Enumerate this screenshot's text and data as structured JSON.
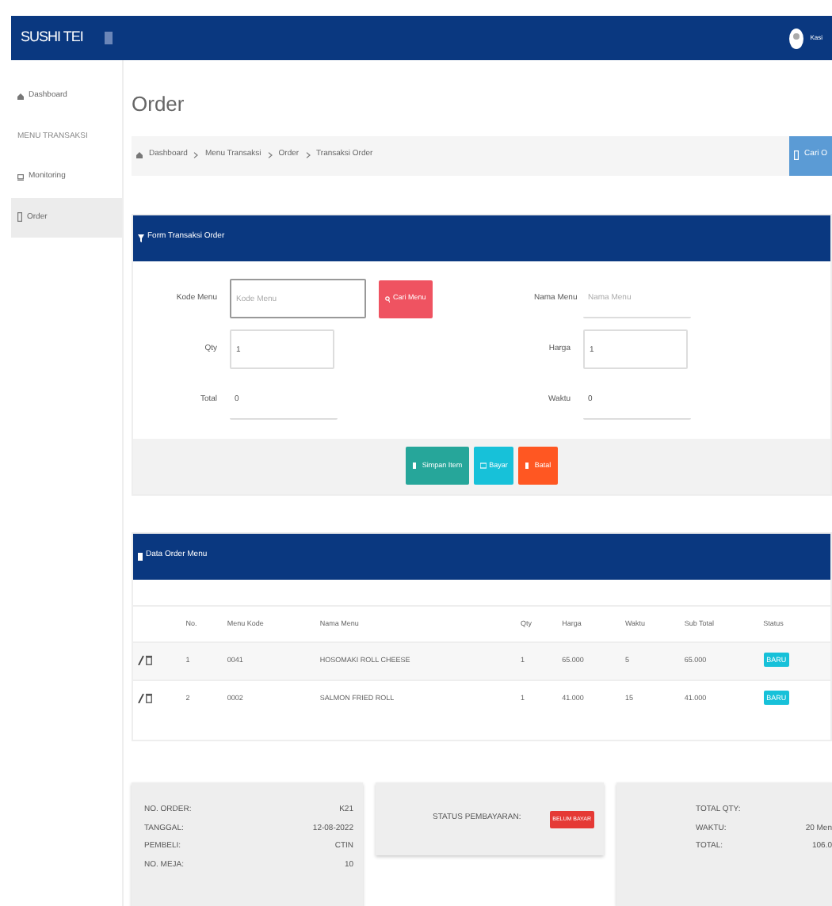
{
  "navbar": {
    "brand": "SUSHI TEI",
    "user": "Kasi"
  },
  "sidebar": {
    "items": [
      {
        "kind": "link",
        "label": "Dashboard",
        "selected": false
      },
      {
        "kind": "heading",
        "label": "MENU TRANSAKSI"
      },
      {
        "kind": "link",
        "label": "Monitoring",
        "selected": false
      },
      {
        "kind": "link",
        "label": "Order",
        "selected": true
      }
    ]
  },
  "page_title": "Order",
  "breadcrumb": [
    "Dashboard",
    "Menu Transaksi",
    "Order",
    "Transaksi Order"
  ],
  "search_order_button": "Cari O",
  "form": {
    "title": "Form Transaksi Order",
    "left": [
      {
        "label": "Kode Menu",
        "placeholder": "Kode Menu",
        "kind": "search",
        "button": "Cari Menu"
      },
      {
        "label": "Qty",
        "value": "1",
        "kind": "box"
      },
      {
        "label": "Total",
        "value": "0",
        "kind": "line"
      }
    ],
    "right": [
      {
        "label": "Nama Menu",
        "placeholder": "Nama Menu",
        "kind": "line"
      },
      {
        "label": "Harga",
        "value": "1",
        "kind": "box"
      },
      {
        "label": "Waktu",
        "value": "0",
        "kind": "line"
      }
    ],
    "buttons": [
      {
        "label": "Simpan Item",
        "color": "#26a69a"
      },
      {
        "label": "Bayar",
        "color": "#17c1d9"
      },
      {
        "label": "Batal",
        "color": "#ff5722"
      }
    ]
  },
  "table": {
    "title": "Data Order Menu",
    "columns": [
      "No.",
      "Menu Kode",
      "Nama Menu",
      "Qty",
      "Harga",
      "Waktu",
      "Sub Total",
      "Status"
    ],
    "rows": [
      {
        "cells": [
          "1",
          "0041",
          "HOSOMAKI ROLL CHEESE",
          "1",
          "65.000",
          "5",
          "65.000"
        ],
        "status": "BARU"
      },
      {
        "cells": [
          "2",
          "0002",
          "SALMON FRIED ROLL",
          "1",
          "41.000",
          "15",
          "41.000"
        ],
        "status": "BARU"
      }
    ]
  },
  "summary": {
    "order": [
      {
        "label": "NO. ORDER:",
        "value": "K21"
      },
      {
        "label": "TANGGAL:",
        "value": "12-08-2022"
      },
      {
        "label": "PEMBELI:",
        "value": "CTIN"
      },
      {
        "label": "NO. MEJA:",
        "value": "10"
      }
    ],
    "payment": {
      "label": "STATUS PEMBAYARAN:",
      "status": "BELUM BAYAR"
    },
    "totals": [
      {
        "label": "TOTAL QTY:"
      },
      {
        "label": "WAKTU:",
        "value": "20 Men"
      },
      {
        "label": "TOTAL:",
        "value": "106.0"
      }
    ]
  }
}
